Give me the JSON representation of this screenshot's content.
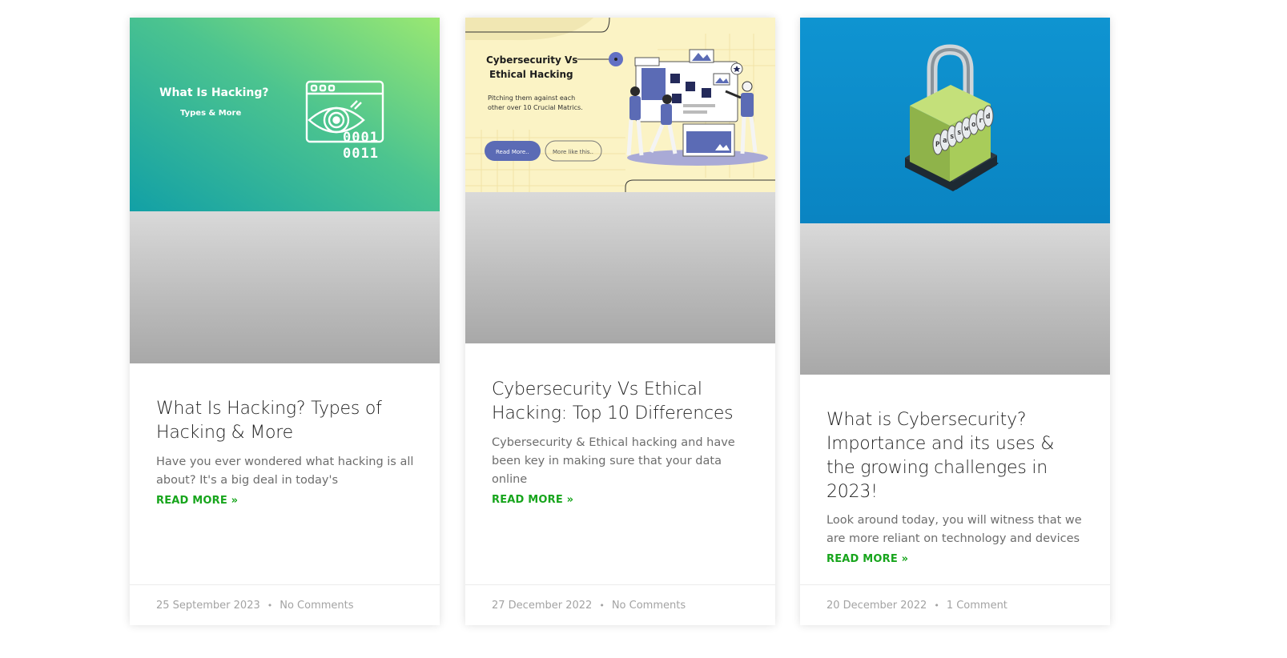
{
  "posts": [
    {
      "thumbnail": {
        "heading": "What Is Hacking?",
        "subheading": "Types & More",
        "binary_lines": [
          "0001",
          "0011"
        ],
        "icon": "eye-window-icon"
      },
      "title": "What Is Hacking? Types of Hacking & More",
      "excerpt": "Have you ever wondered what hacking is all about? It's a big deal in today's",
      "read_more": "READ MORE »",
      "date": "25 September 2023",
      "separator": "•",
      "comments": "No Comments"
    },
    {
      "thumbnail": {
        "heading_line1": "Cybersecurity Vs",
        "heading_line2": "Ethical Hacking",
        "tagline_line1": "Pitching them against each",
        "tagline_line2": "other over 10 Crucial Matrics.",
        "button_primary": "Read More..",
        "button_secondary": "More like this.."
      },
      "title": "Cybersecurity Vs Ethical Hacking: Top 10 Differences",
      "excerpt": "Cybersecurity & Ethical hacking and have been key in making sure that your data online",
      "read_more": "READ MORE »",
      "date": "27 December 2022",
      "separator": "•",
      "comments": "No Comments"
    },
    {
      "thumbnail": {
        "lock_letters": [
          "P",
          "a",
          "s",
          "s",
          "w",
          "o",
          "r",
          "d"
        ],
        "icon": "combination-padlock-icon"
      },
      "title": "What is Cybersecurity? Importance and its uses & the growing challenges in 2023!",
      "excerpt": "Look around today, you will witness that we are more reliant on technology and devices",
      "read_more": "READ MORE »",
      "date": "20 December 2022",
      "separator": "•",
      "comments": "1 Comment"
    }
  ],
  "colors": {
    "accent_link": "#17a51c",
    "thumb1_gradient_start": "#16a3a3",
    "thumb1_gradient_end": "#96e875",
    "thumb2_background": "#fbf3c5",
    "thumb2_accent": "#5b6bb5",
    "thumb3_background": "#0e91cf"
  }
}
